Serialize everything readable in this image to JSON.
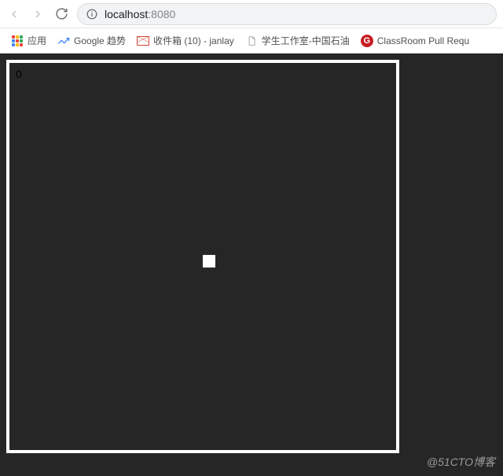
{
  "toolbar": {
    "url_host": "localhost",
    "url_port": ":8080"
  },
  "bookmarks": {
    "apps": "应用",
    "trends": "Google 趋势",
    "gmail": "收件箱 (10) - janlay",
    "studio": "学生工作室-中国石油",
    "gitee": "ClassRoom Pull Requ"
  },
  "game": {
    "score": "0"
  },
  "watermark": "@51CTO博客"
}
